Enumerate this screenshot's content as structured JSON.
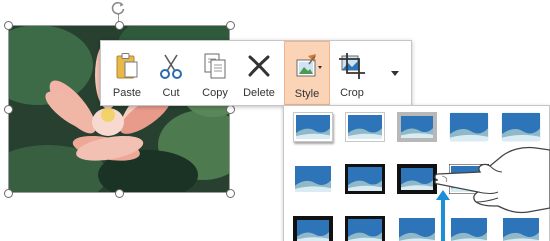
{
  "toolbar": {
    "buttons": [
      {
        "id": "paste",
        "label": "Paste",
        "icon": "clipboard-icon"
      },
      {
        "id": "cut",
        "label": "Cut",
        "icon": "scissors-icon"
      },
      {
        "id": "copy",
        "label": "Copy",
        "icon": "copy-icon"
      },
      {
        "id": "delete",
        "label": "Delete",
        "icon": "delete-x-icon"
      },
      {
        "id": "style",
        "label": "Style",
        "icon": "picture-style-icon",
        "active": true
      },
      {
        "id": "crop",
        "label": "Crop",
        "icon": "crop-icon"
      }
    ],
    "more_icon": "chevron-down-icon"
  },
  "photo": {
    "subject": "lotus-flower-image"
  },
  "gallery": {
    "rows": 3,
    "columns": 5,
    "hover_cursor": "hand-pointer-icon",
    "hover_indicator": "up-arrow-icon"
  },
  "colors": {
    "active_button_bg": "#fbd4b8",
    "arrow": "#1d8fd6",
    "thumb_sky": "#2d74b8",
    "thumb_hill": "#8fb9c9"
  }
}
